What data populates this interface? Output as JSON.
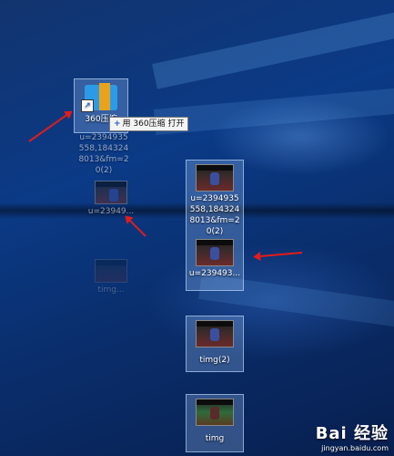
{
  "desktop": {
    "icons": [
      {
        "label": "360压缩",
        "label_lines": [
          "u=2394935",
          "558,184324",
          "8013&fm=2",
          "0(2)"
        ]
      },
      {
        "label": "u=23949..."
      },
      {
        "label": "timg..."
      },
      {
        "label_lines": [
          "u=2394935",
          "558,184324",
          "8013&fm=2",
          "0(2)"
        ]
      },
      {
        "label": "u=239493..."
      },
      {
        "label": "timg(2)"
      },
      {
        "label": "timg"
      }
    ],
    "tooltip": {
      "plus": "+",
      "text": "用 360压缩 打开"
    }
  },
  "watermark": {
    "logo": "Bai 经验",
    "url": "jingyan.baidu.com"
  },
  "annotation_color": "#e21b1b"
}
